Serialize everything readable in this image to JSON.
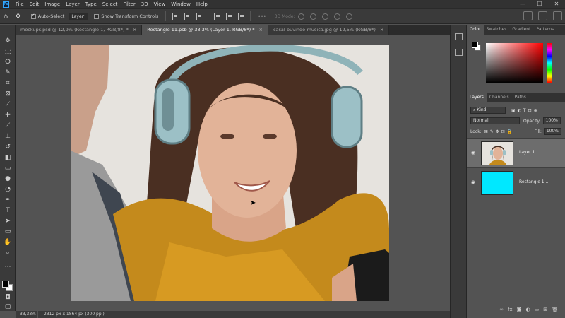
{
  "app": {
    "logo": "Ps"
  },
  "menu": [
    "File",
    "Edit",
    "Image",
    "Layer",
    "Type",
    "Select",
    "Filter",
    "3D",
    "View",
    "Window",
    "Help"
  ],
  "window_controls": [
    "—",
    "☐",
    "✕"
  ],
  "options_bar": {
    "auto_select_label": "Auto-Select",
    "auto_select_checked": true,
    "layer_select_value": "Layer",
    "transform_controls_label": "Show Transform Controls",
    "transform_controls_checked": false,
    "more_label": "•••",
    "mode_3d_label": "3D Mode:"
  },
  "tabs": [
    {
      "label": "mockups.psd @ 12,9% (Rectangle 1, RGB/8*) *",
      "active": false
    },
    {
      "label": "Rectangle 11.psb @ 33,3% (Layer 1, RGB/8*) *",
      "active": true
    },
    {
      "label": "casal-ouvindo-musica.jpg @ 12,5% (RGB/8*)",
      "active": false
    }
  ],
  "tab_close": "×",
  "status": {
    "zoom": "33,33%",
    "doc_info": "2312 px x 1864 px (300 ppi)"
  },
  "color_panel": {
    "tabs": [
      "Color",
      "Swatches",
      "Gradient",
      "Patterns"
    ],
    "fg_color": "#000000",
    "bg_color": "#ffffff"
  },
  "layers_panel": {
    "tabs": [
      "Layers",
      "Channels",
      "Paths"
    ],
    "filter_kind": "Kind",
    "blend_mode": "Normal",
    "opacity_label": "Opacity:",
    "opacity_value": "100%",
    "lock_label": "Lock:",
    "fill_label": "Fill:",
    "fill_value": "100%",
    "layers": [
      {
        "name": "Layer 1",
        "selected": true,
        "thumb": "photo"
      },
      {
        "name": "Rectangle 1...",
        "selected": false,
        "thumb": "cyan"
      }
    ]
  },
  "accent_colors": {
    "cyan_layer": "#00e8ff",
    "selection": "#6d6d6d"
  }
}
